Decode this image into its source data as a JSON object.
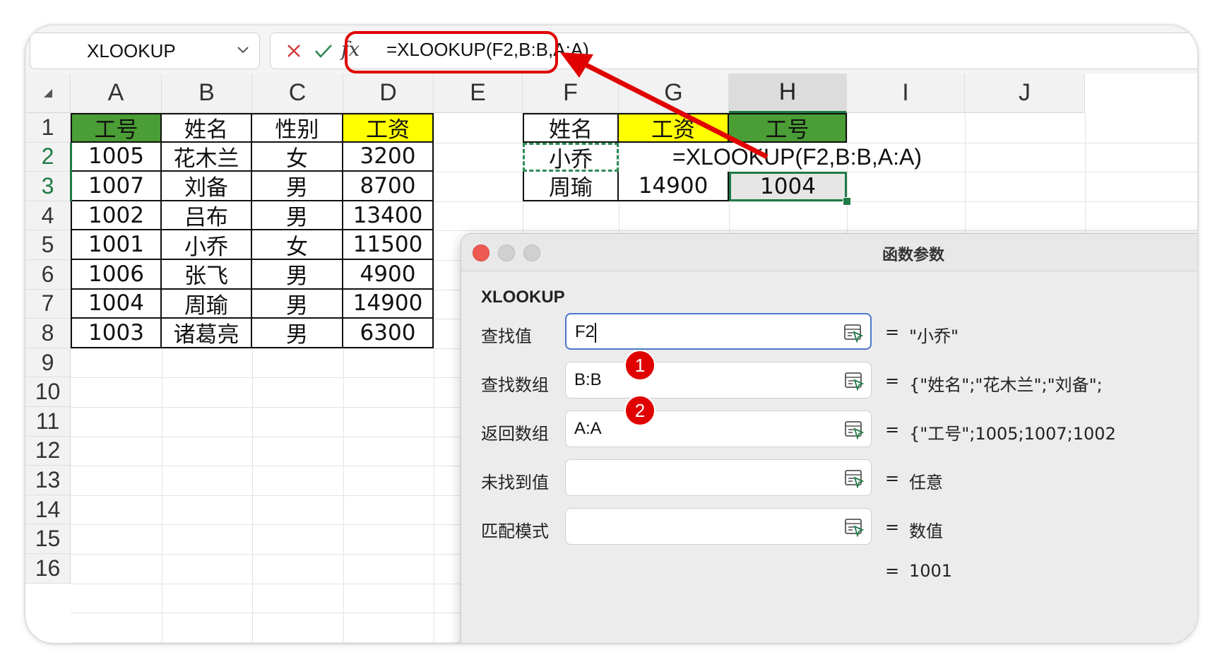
{
  "name_box": {
    "value": "XLOOKUP"
  },
  "formula_bar": {
    "fx_label": "fx",
    "formula": "=XLOOKUP(F2,B:B,A:A)"
  },
  "colors": {
    "header_green": "#4a9e35",
    "header_yellow": "#ffff00",
    "selection_green": "#1f7a45",
    "annotation_red": "#e00000"
  },
  "columns": [
    "A",
    "B",
    "C",
    "D",
    "E",
    "F",
    "G",
    "H",
    "I",
    "J"
  ],
  "rows": [
    "1",
    "2",
    "3",
    "4",
    "5",
    "6",
    "7",
    "8",
    "9",
    "10",
    "11",
    "12",
    "13",
    "14",
    "15",
    "16"
  ],
  "table_main": {
    "headers": [
      "工号",
      "姓名",
      "性别",
      "工资"
    ],
    "rows": [
      [
        "1005",
        "花木兰",
        "女",
        "3200"
      ],
      [
        "1007",
        "刘备",
        "男",
        "8700"
      ],
      [
        "1002",
        "吕布",
        "男",
        "13400"
      ],
      [
        "1001",
        "小乔",
        "女",
        "11500"
      ],
      [
        "1006",
        "张飞",
        "男",
        "4900"
      ],
      [
        "1004",
        "周瑜",
        "男",
        "14900"
      ],
      [
        "1003",
        "诸葛亮",
        "男",
        "6300"
      ]
    ]
  },
  "table_lookup": {
    "headers": [
      "姓名",
      "工资",
      "工号"
    ],
    "row1": {
      "name": "小乔",
      "formula": "=XLOOKUP(F2,B:B,A:A)"
    },
    "row2": {
      "name": "周瑜",
      "salary": "14900",
      "id": "1004"
    }
  },
  "dialog": {
    "title": "函数参数",
    "function_name": "XLOOKUP",
    "args": [
      {
        "label": "查找值",
        "value": "F2",
        "result": "\"小乔\""
      },
      {
        "label": "查找数组",
        "value": "B:B",
        "result": "{\"姓名\";\"花木兰\";\"刘备\";"
      },
      {
        "label": "返回数组",
        "value": "A:A",
        "result": "{\"工号\";1005;1007;1002"
      },
      {
        "label": "未找到值",
        "value": "",
        "result": "任意"
      },
      {
        "label": "匹配模式",
        "value": "",
        "result": "数值"
      }
    ],
    "eq": "=",
    "final_result": "1001"
  },
  "badges": [
    "1",
    "2"
  ]
}
